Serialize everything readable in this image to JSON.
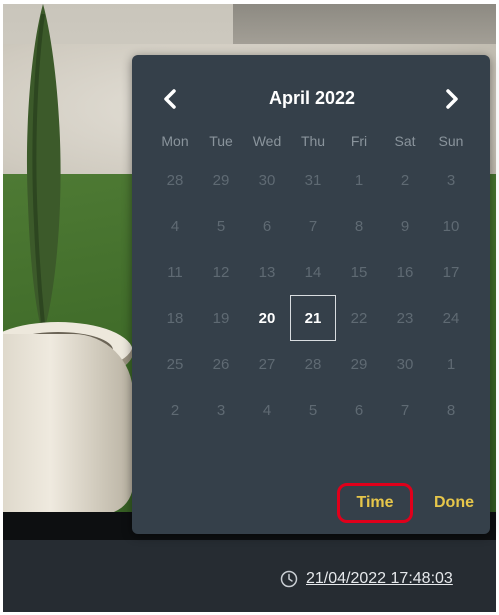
{
  "calendar": {
    "month_title": "April 2022",
    "prev_icon": "chevron-left-icon",
    "next_icon": "chevron-right-icon",
    "weekdays": [
      "Mon",
      "Tue",
      "Wed",
      "Thu",
      "Fri",
      "Sat",
      "Sun"
    ],
    "weeks": [
      [
        "28",
        "29",
        "30",
        "31",
        "1",
        "2",
        "3"
      ],
      [
        "4",
        "5",
        "6",
        "7",
        "8",
        "9",
        "10"
      ],
      [
        "11",
        "12",
        "13",
        "14",
        "15",
        "16",
        "17"
      ],
      [
        "18",
        "19",
        "20",
        "21",
        "22",
        "23",
        "24"
      ],
      [
        "25",
        "26",
        "27",
        "28",
        "29",
        "30",
        "1"
      ],
      [
        "2",
        "3",
        "4",
        "5",
        "6",
        "7",
        "8"
      ]
    ],
    "enabled_days": [
      "20",
      "21"
    ],
    "selected_day": "21",
    "time_label": "Time",
    "done_label": "Done",
    "accent_color": "#e6c64a",
    "highlight_color": "#e0001b"
  },
  "footer": {
    "clock_icon": "clock-icon",
    "timestamp": "21/04/2022 17:48:03"
  }
}
